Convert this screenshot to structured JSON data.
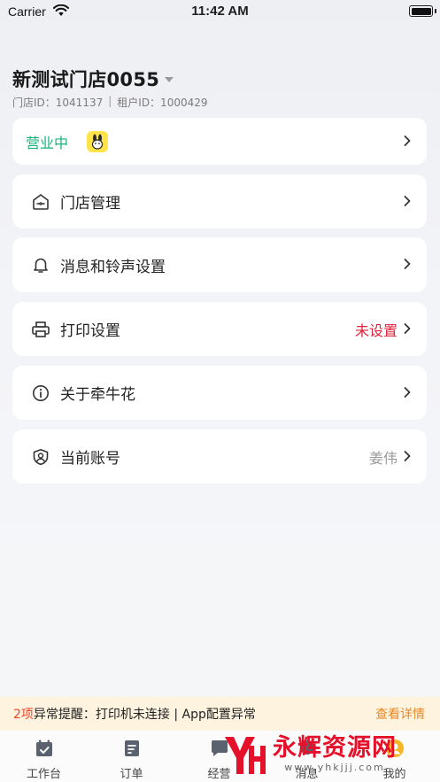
{
  "status_bar": {
    "carrier": "Carrier",
    "time": "11:42 AM"
  },
  "store": {
    "name": "新测试门店0055",
    "store_id": "门店ID：1041137",
    "separator": "|",
    "tenant_id": "租户ID：1000429"
  },
  "business_status": {
    "label": "营业中"
  },
  "menu": {
    "store_management": {
      "label": "门店管理",
      "icon": "store-icon"
    },
    "message_ringtone": {
      "label": "消息和铃声设置",
      "icon": "bell-icon"
    },
    "print_settings": {
      "label": "打印设置",
      "value": "未设置",
      "icon": "printer-icon"
    },
    "about": {
      "label": "关于牵牛花",
      "icon": "info-icon"
    },
    "current_account": {
      "label": "当前账号",
      "value": "姜伟",
      "icon": "user-shield-icon"
    }
  },
  "alert": {
    "count": "2项",
    "text": "异常提醒：打印机未连接 | App配置异常",
    "link": "查看详情"
  },
  "tabs": [
    {
      "label": "工作台",
      "icon": "calendar-icon"
    },
    {
      "label": "订单",
      "icon": "document-icon"
    },
    {
      "label": "经营",
      "icon": "chat-icon"
    },
    {
      "label": "消息",
      "icon": "message-icon"
    },
    {
      "label": "我的",
      "icon": "profile-icon"
    }
  ],
  "watermark": {
    "title": "永辉资源网",
    "url": "www.yhkjjj.com"
  },
  "colors": {
    "open_status": "#19b37a",
    "warning_red": "#e0233a",
    "alert_bg": "#fdf3de",
    "alert_link": "#e98824",
    "watermark_red": "#e5102a"
  }
}
